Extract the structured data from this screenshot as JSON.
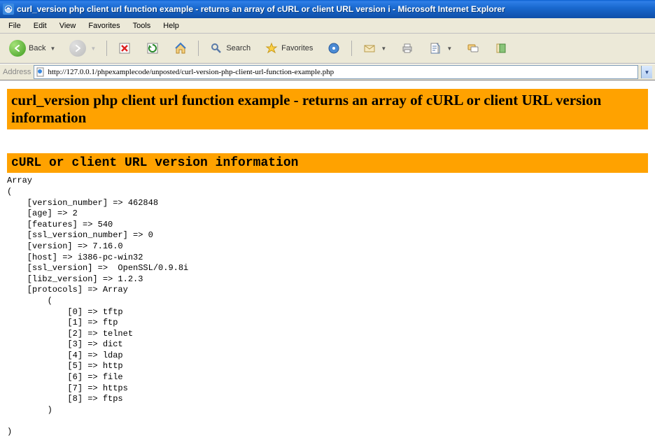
{
  "titlebar": {
    "text": "curl_version php client url function example - returns an array of cURL or client URL version i - Microsoft Internet Explorer"
  },
  "menubar": {
    "items": [
      "File",
      "Edit",
      "View",
      "Favorites",
      "Tools",
      "Help"
    ]
  },
  "toolbar": {
    "back": "Back",
    "search": "Search",
    "favorites": "Favorites"
  },
  "addressbar": {
    "label": "Address",
    "url": "http://127.0.0.1/phpexamplecode/unposted/curl-version-php-client-url-function-example.php"
  },
  "content": {
    "heading": "curl_version php client url function example - returns an array of cURL or client URL version information",
    "subheading": "cURL or client URL version information",
    "array_output": "Array\n(\n    [version_number] => 462848\n    [age] => 2\n    [features] => 540\n    [ssl_version_number] => 0\n    [version] => 7.16.0\n    [host] => i386-pc-win32\n    [ssl_version] =>  OpenSSL/0.9.8i\n    [libz_version] => 1.2.3\n    [protocols] => Array\n        (\n            [0] => tftp\n            [1] => ftp\n            [2] => telnet\n            [3] => dict\n            [4] => ldap\n            [5] => http\n            [6] => file\n            [7] => https\n            [8] => ftps\n        )\n\n)"
  }
}
